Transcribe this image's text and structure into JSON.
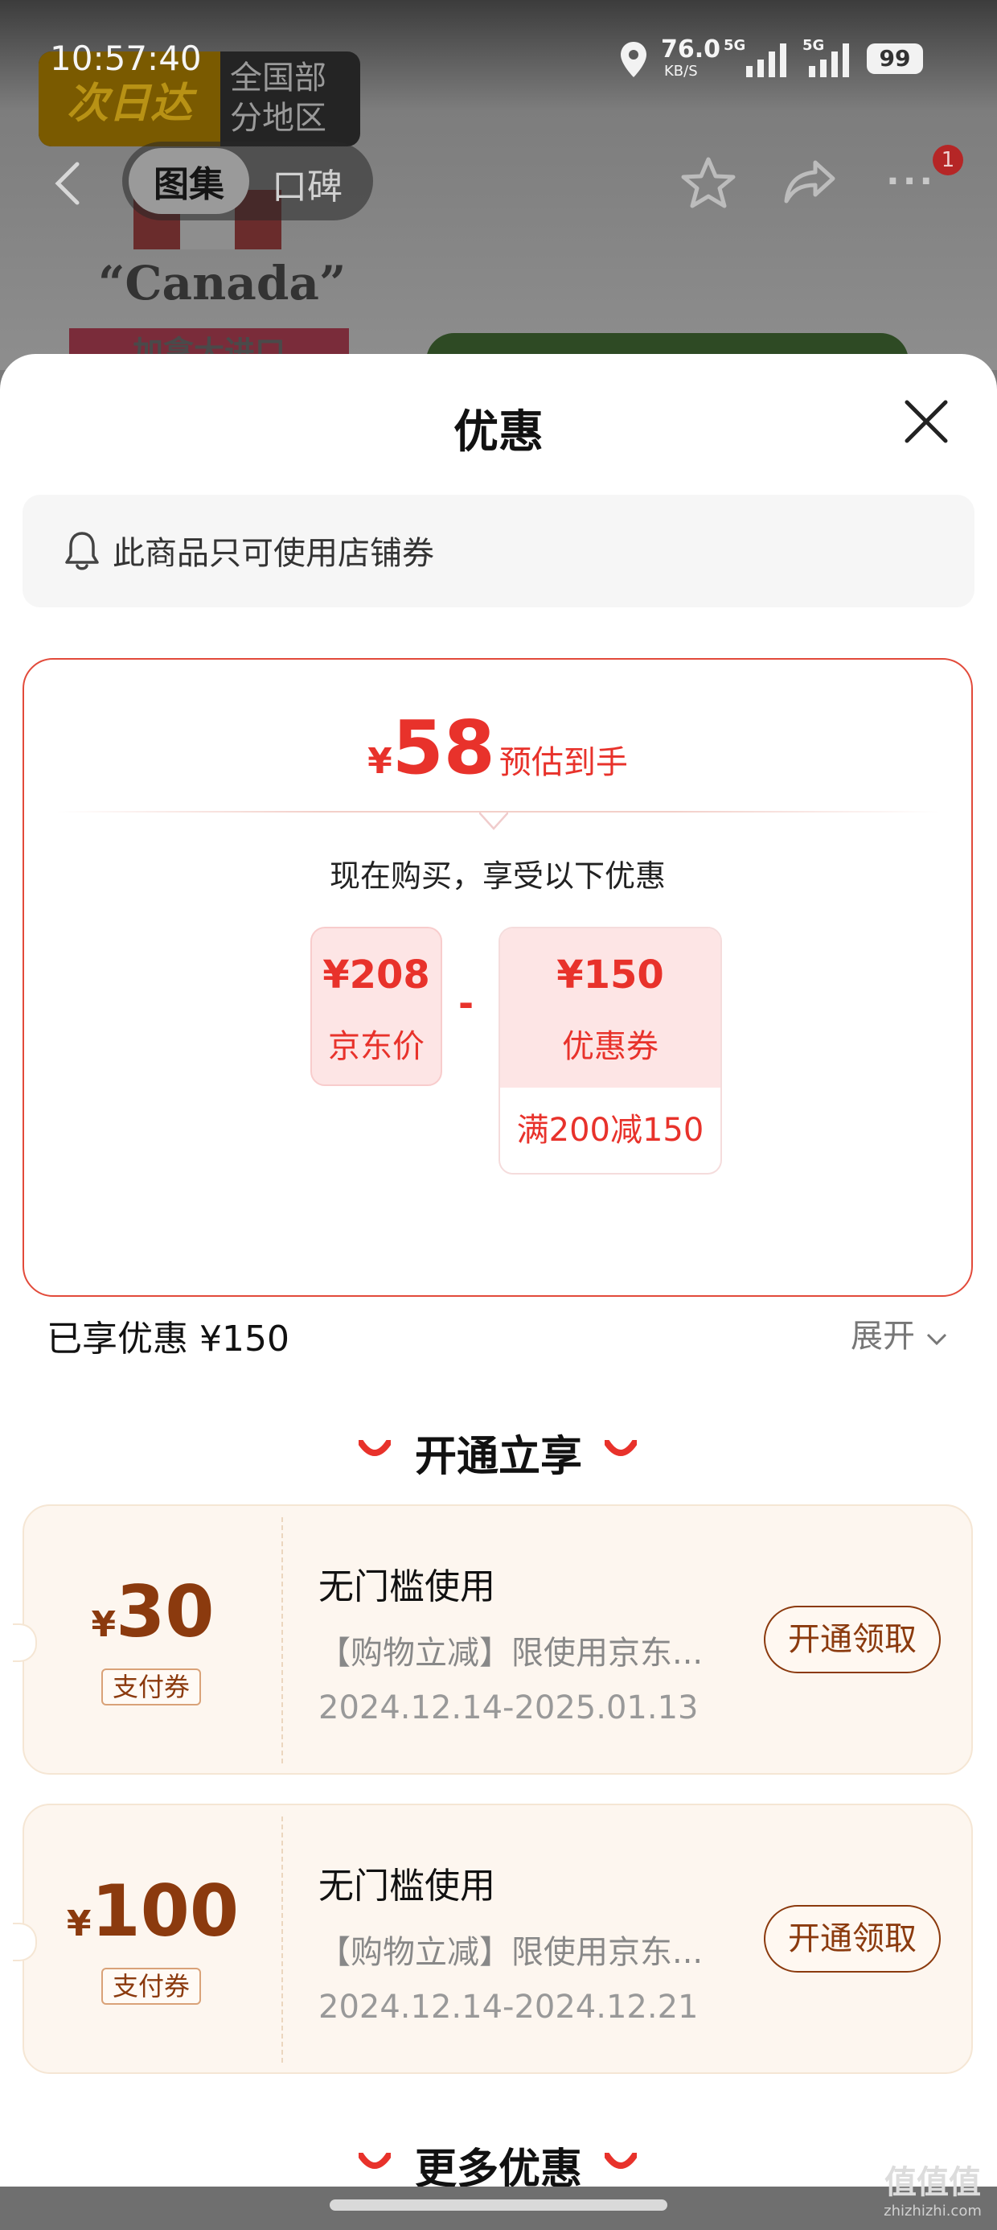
{
  "status_bar": {
    "time": "10:57:40",
    "net_speed": "76.0",
    "net_unit": "KB/S",
    "sig1": "5G",
    "sig2": "5G",
    "battery": "99"
  },
  "background_page": {
    "shop_badge_left": "次日达",
    "shop_badge_right": "全国部分地区",
    "tabs": [
      "图集",
      "口碑"
    ],
    "product_text": "“Canada”",
    "import_tag": "加拿大进口",
    "notification_count": "1"
  },
  "sheet": {
    "title": "优惠",
    "notice": "此商品只可使用店铺券",
    "estimate": {
      "currency": "¥",
      "price": "58",
      "label": "预估到手"
    },
    "buy_text": "现在购买，享受以下优惠",
    "jd_price": {
      "value": "¥208",
      "label": "京东价"
    },
    "operator": "-",
    "coupon_card": {
      "value": "¥150",
      "label": "优惠券",
      "condition": "满200减150"
    },
    "enjoyed": "已享优惠 ¥150",
    "expand": "展开",
    "section_open": "开通立享",
    "coupons": [
      {
        "currency": "¥",
        "amount": "30",
        "tag": "支付券",
        "title": "无门槛使用",
        "desc": "【购物立减】限使用京东...",
        "date": "2024.12.14-2025.01.13",
        "button": "开通领取"
      },
      {
        "currency": "¥",
        "amount": "100",
        "tag": "支付券",
        "title": "无门槛使用",
        "desc": "【购物立减】限使用京东...",
        "date": "2024.12.14-2024.12.21",
        "button": "开通领取"
      }
    ],
    "section_more": "更多优惠"
  },
  "watermark": {
    "logo": "值值值",
    "site": "zhizhizhi.com"
  },
  "colors": {
    "accent_red": "#e8322b",
    "coupon_brown": "#8b3a0e"
  }
}
